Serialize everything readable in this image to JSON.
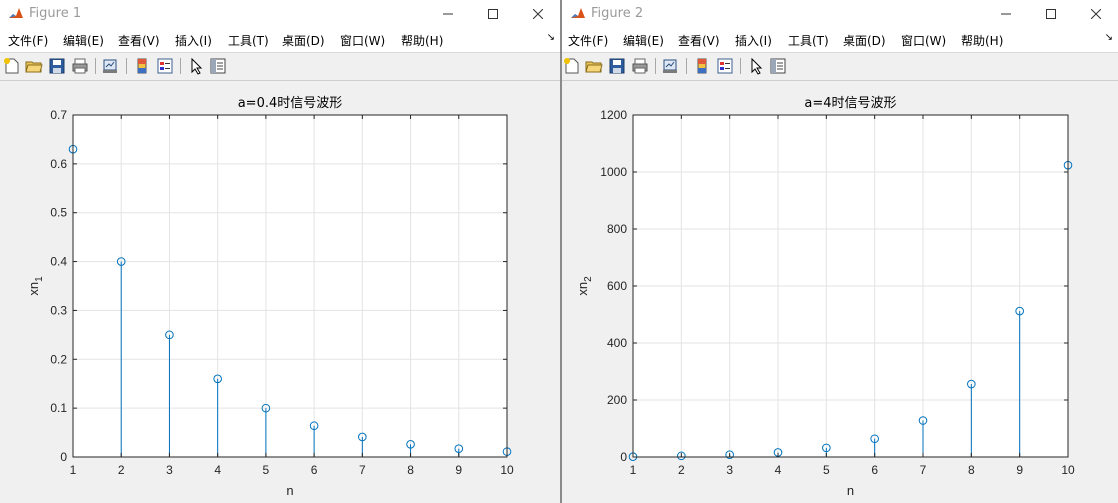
{
  "figures": [
    {
      "title": "Figure 1",
      "menus": [
        "文件(F)",
        "编辑(E)",
        "查看(V)",
        "插入(I)",
        "工具(T)",
        "桌面(D)",
        "窗口(W)",
        "帮助(H)"
      ]
    },
    {
      "title": "Figure 2",
      "menus": [
        "文件(F)",
        "编辑(E)",
        "查看(V)",
        "插入(I)",
        "工具(T)",
        "桌面(D)",
        "窗口(W)",
        "帮助(H)"
      ]
    }
  ],
  "toolbar_icons": [
    "new-figure-icon",
    "open-file-icon",
    "save-icon",
    "print-icon",
    "link-plot-icon",
    "insert-colorbar-icon",
    "insert-legend-icon",
    "edit-plot-arrow-icon",
    "property-inspector-icon"
  ],
  "colors": {
    "stem": "#0072bd",
    "grid": "#e3e3e3",
    "axes": "#262626"
  },
  "chart_data": [
    {
      "type": "stem",
      "title": "a=0.4时信号波形",
      "xlabel": "n",
      "ylabel": "xn",
      "ylabel_sub": "1",
      "x": [
        1,
        2,
        3,
        4,
        5,
        6,
        7,
        8,
        9,
        10
      ],
      "y": [
        0.63,
        0.4,
        0.25,
        0.16,
        0.1,
        0.064,
        0.041,
        0.026,
        0.017,
        0.011
      ],
      "xlim": [
        1,
        10
      ],
      "ylim": [
        0,
        0.7
      ],
      "xticks": [
        "1",
        "2",
        "3",
        "4",
        "5",
        "6",
        "7",
        "8",
        "9",
        "10"
      ],
      "yticks": [
        "0",
        "0.1",
        "0.2",
        "0.3",
        "0.4",
        "0.5",
        "0.6",
        "0.7"
      ],
      "grid": true
    },
    {
      "type": "stem",
      "title": "a=4时信号波形",
      "xlabel": "n",
      "ylabel": "xn",
      "ylabel_sub": "2",
      "x": [
        1,
        2,
        3,
        4,
        5,
        6,
        7,
        8,
        9,
        10
      ],
      "y": [
        1,
        4,
        8,
        16,
        32,
        64,
        128,
        256,
        512,
        1024
      ],
      "xlim": [
        1,
        10
      ],
      "ylim": [
        0,
        1200
      ],
      "xticks": [
        "1",
        "2",
        "3",
        "4",
        "5",
        "6",
        "7",
        "8",
        "9",
        "10"
      ],
      "yticks": [
        "0",
        "200",
        "400",
        "600",
        "800",
        "1000",
        "1200"
      ],
      "grid": true
    }
  ]
}
